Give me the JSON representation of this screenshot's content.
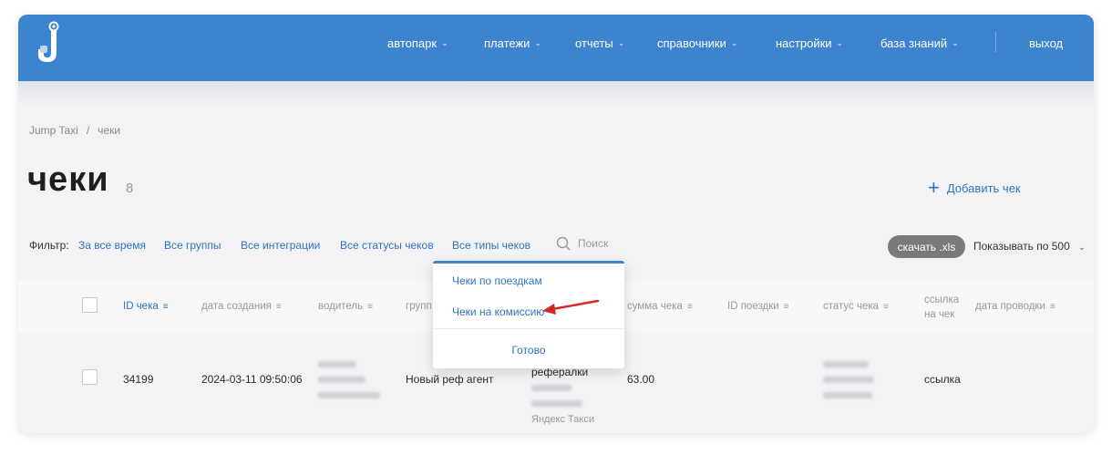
{
  "colors": {
    "brand": "#3d84cf",
    "link": "#2f74c0",
    "annotation_arrow": "#d62828"
  },
  "nav": [
    {
      "label": "автопарк",
      "icon": "chevron-down-icon"
    },
    {
      "label": "платежи",
      "icon": "chevron-down-icon"
    },
    {
      "label": "отчеты",
      "icon": "chevron-down-icon"
    },
    {
      "label": "справочники",
      "icon": "chevron-down-icon"
    },
    {
      "label": "настройки",
      "icon": "chevron-down-icon"
    },
    {
      "label": "база знаний",
      "icon": "chevron-down-icon"
    }
  ],
  "logout_label": "выход",
  "breadcrumb": {
    "root": "Jump Taxi",
    "separator": "/",
    "current": "чеки"
  },
  "page": {
    "title": "чеки",
    "count": "8",
    "add_label": "Добавить чек"
  },
  "filters": {
    "label": "Фильтр:",
    "period": "За все время",
    "groups": "Все группы",
    "integrations": "Все интеграции",
    "statuses": "Все статусы чеков",
    "types": "Все типы чеков",
    "search_placeholder": "Поиск"
  },
  "download_label": "скачать .xls",
  "per_page_label": "Показывать по 500",
  "table": {
    "columns": {
      "id": "ID чека",
      "created": "дата создания",
      "driver": "водитель",
      "group": "групп",
      "amount": "сумма чека",
      "trip_id": "ID поездки",
      "status": "статус чека",
      "link_line1": "ссылка",
      "link_line2": "на чек",
      "posted": "дата проводки"
    },
    "rows": [
      {
        "id": "34199",
        "created": "2024-03-11 09:50:06",
        "group": "Новый реф агент",
        "integration_title": "рефералки",
        "integration_sub": "Яндекс Такси",
        "amount": "63.00",
        "link": "ссылка"
      }
    ]
  },
  "dropdown": {
    "items": [
      "Чеки по поездкам",
      "Чеки на комиссию"
    ],
    "done_label": "Готово"
  }
}
